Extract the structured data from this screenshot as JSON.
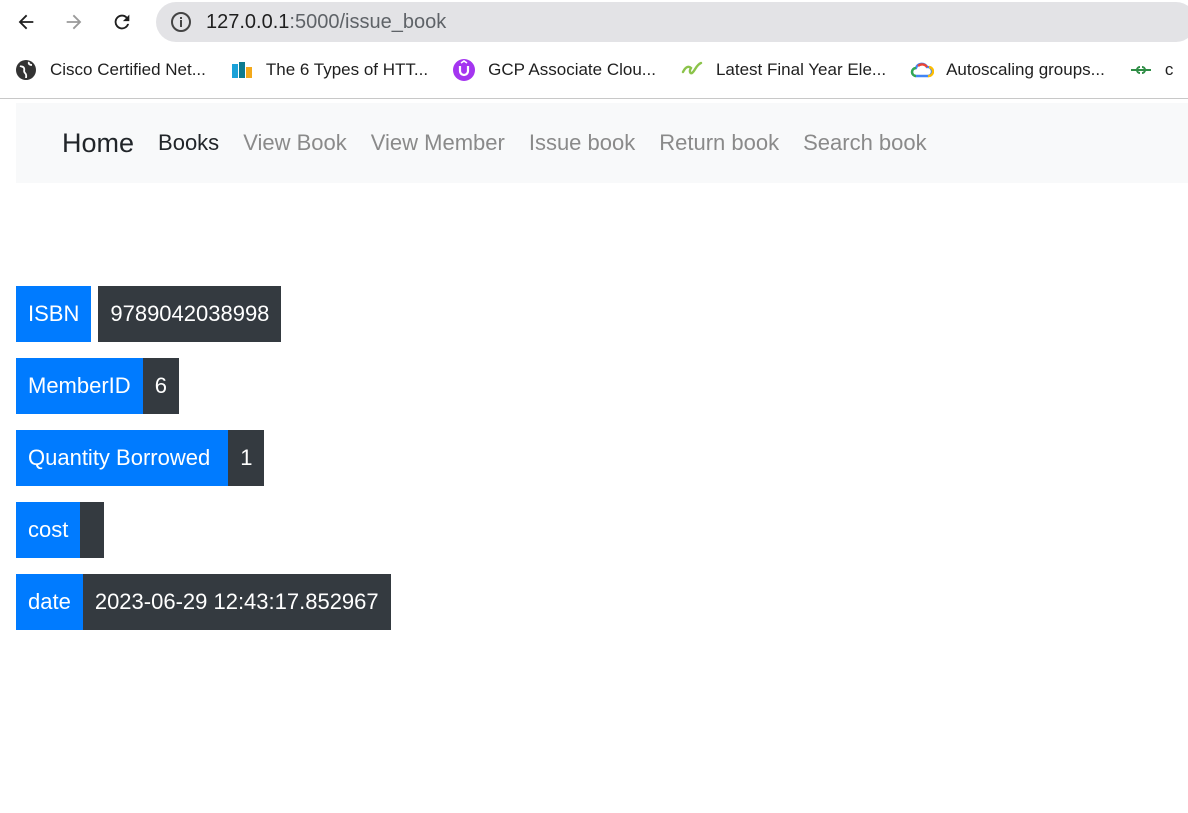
{
  "browser": {
    "url_host": "127.0.0.1",
    "url_path": ":5000/issue_book",
    "bookmarks": [
      {
        "label": "Cisco Certified Net...",
        "icon": "globe-icon"
      },
      {
        "label": "The 6 Types of HTT...",
        "icon": "bookmark-site-icon"
      },
      {
        "label": "GCP Associate Clou...",
        "icon": "udemy-icon"
      },
      {
        "label": "Latest Final Year Ele...",
        "icon": "leaf-icon"
      },
      {
        "label": "Autoscaling groups...",
        "icon": "google-cloud-icon"
      },
      {
        "label": "c",
        "icon": "geeksforgeeks-icon"
      }
    ]
  },
  "navbar": {
    "brand": "Home",
    "links": [
      {
        "label": "Books",
        "active": true
      },
      {
        "label": "View Book",
        "active": false
      },
      {
        "label": "View Member",
        "active": false
      },
      {
        "label": "Issue book",
        "active": false
      },
      {
        "label": "Return book",
        "active": false
      },
      {
        "label": "Search book",
        "active": false
      }
    ]
  },
  "record": [
    {
      "label": "ISBN",
      "value": "9789042038998"
    },
    {
      "label": "MemberID",
      "value": "6"
    },
    {
      "label": "Quantity Borrowed",
      "value": "1"
    },
    {
      "label": "cost",
      "value": ""
    },
    {
      "label": "date",
      "value": "2023-06-29 12:43:17.852967"
    }
  ],
  "colors": {
    "label_bg": "#007bff",
    "value_bg": "#343a40",
    "navbar_bg": "#f8f9fa"
  }
}
